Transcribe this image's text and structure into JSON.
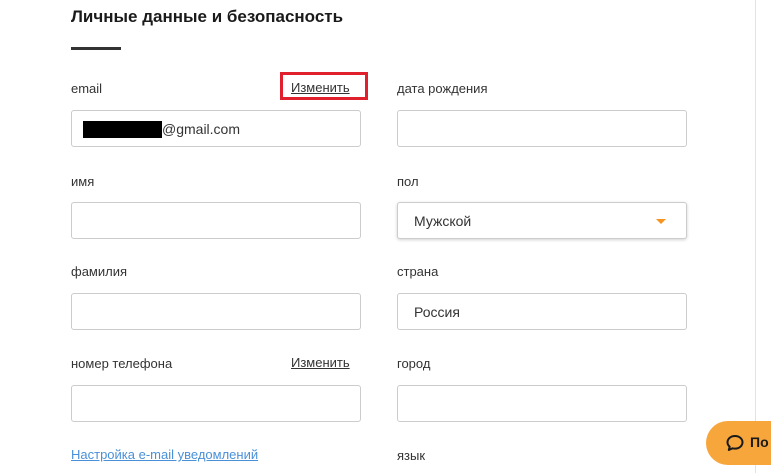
{
  "section": {
    "title": "Личные данные и безопасность"
  },
  "left_column": {
    "email": {
      "label": "email",
      "change_label": "Изменить",
      "value_masked": "[redacted]",
      "value_suffix": "@gmail.com"
    },
    "first_name": {
      "label": "имя",
      "value": ""
    },
    "last_name": {
      "label": "фамилия",
      "value": ""
    },
    "phone": {
      "label": "номер телефона",
      "change_label": "Изменить",
      "value": ""
    },
    "notifications_link": "Настройка e-mail уведомлений"
  },
  "right_column": {
    "birth_date": {
      "label": "дата рождения",
      "value": ""
    },
    "gender": {
      "label": "пол",
      "selected": "Мужской"
    },
    "country": {
      "label": "страна",
      "value": "Россия"
    },
    "city": {
      "label": "город",
      "value": ""
    },
    "language": {
      "label": "язык"
    }
  },
  "chat": {
    "label": "По",
    "icon": "chat-bubble-icon"
  },
  "colors": {
    "accent_orange": "#f7941d",
    "chat_button": "#f7a63b",
    "highlight_red": "#e0202c",
    "link_blue": "#4a90d9"
  }
}
